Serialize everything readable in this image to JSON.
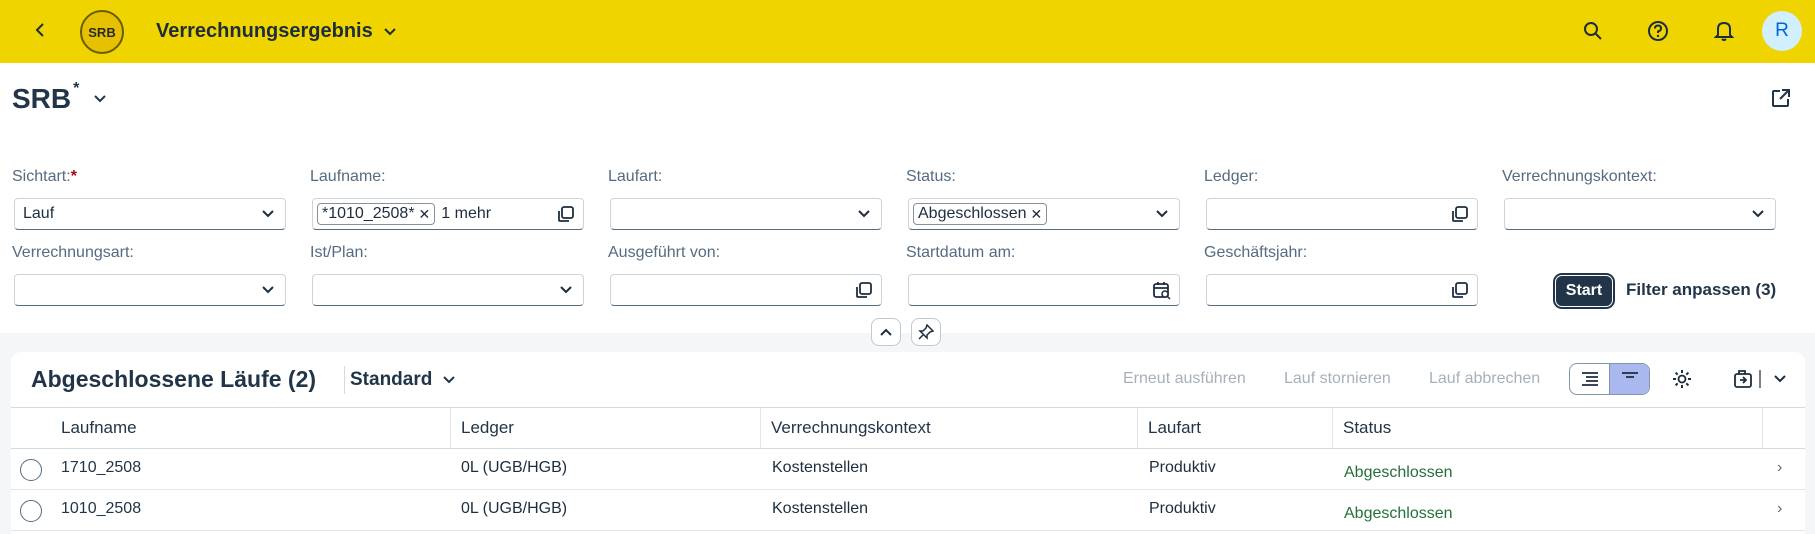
{
  "shell": {
    "title": "Verrechnungsergebnis",
    "logo_text": "SRB",
    "avatar_initial": "R"
  },
  "variant": {
    "name": "SRB",
    "modified_marker": "*"
  },
  "filters": {
    "sichtart": {
      "label": "Sichtart:",
      "required_marker": "*",
      "value": "Lauf"
    },
    "laufname": {
      "label": "Laufname:",
      "token": "*1010_2508*",
      "more": "1 mehr"
    },
    "laufart": {
      "label": "Laufart:",
      "value": ""
    },
    "status": {
      "label": "Status:",
      "token": "Abgeschlossen"
    },
    "ledger": {
      "label": "Ledger:",
      "value": ""
    },
    "verrechnungskontext": {
      "label": "Verrechnungskontext:",
      "value": ""
    },
    "verrechnungsart": {
      "label": "Verrechnungsart:",
      "value": ""
    },
    "ist_plan": {
      "label": "Ist/Plan:",
      "value": ""
    },
    "ausgefuehrt_von": {
      "label": "Ausgeführt von:",
      "value": ""
    },
    "startdatum": {
      "label": "Startdatum am:",
      "value": ""
    },
    "geschaeftsjahr": {
      "label": "Geschäftsjahr:",
      "value": ""
    }
  },
  "filterbar": {
    "start_label": "Start",
    "adapt_label": "Filter anpassen (3)"
  },
  "table": {
    "title": "Abgeschlossene Läufe (2)",
    "variant": "Standard",
    "actions": [
      "Erneut ausführen",
      "Lauf stornieren",
      "Lauf abbrechen"
    ],
    "columns": [
      "Laufname",
      "Ledger",
      "Verrechnungskontext",
      "Laufart",
      "Status"
    ],
    "rows": [
      {
        "laufname": "1710_2508",
        "ledger": "0L (UGB/HGB)",
        "kontext": "Kostenstellen",
        "laufart": "Produktiv",
        "status": "Abgeschlossen"
      },
      {
        "laufname": "1010_2508",
        "ledger": "0L (UGB/HGB)",
        "kontext": "Kostenstellen",
        "laufart": "Produktiv",
        "status": "Abgeschlossen"
      }
    ]
  },
  "colors": {
    "shell": "#f0d400",
    "brand_text": "#223548",
    "success": "#256f3a"
  }
}
